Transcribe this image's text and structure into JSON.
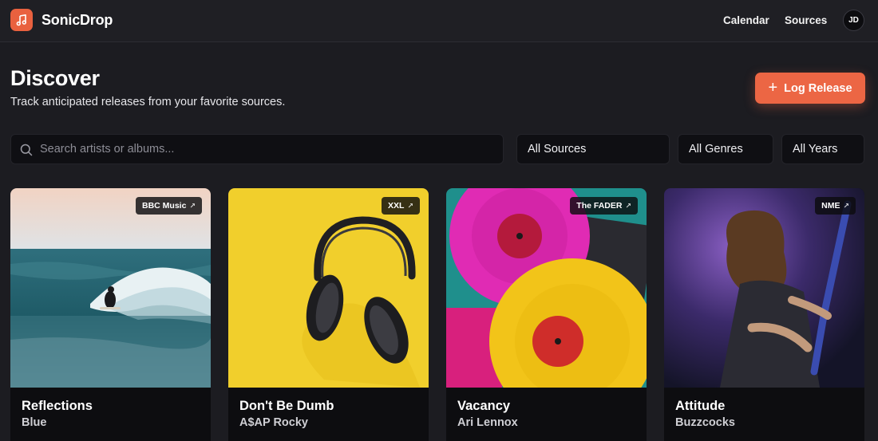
{
  "app": {
    "name": "SonicDrop",
    "logo_icon": "music-note-icon",
    "accent": "#ec6644"
  },
  "nav": {
    "calendar": "Calendar",
    "sources": "Sources",
    "avatar_initials": "JD"
  },
  "header": {
    "title": "Discover",
    "subtitle": "Track anticipated releases from your favorite sources.",
    "log_button": "Log Release"
  },
  "filters": {
    "search_placeholder": "Search artists or albums...",
    "sources": "All Sources",
    "genres": "All Genres",
    "years": "All Years"
  },
  "releases": [
    {
      "title": "Reflections",
      "artist": "Blue",
      "source": "BBC Music"
    },
    {
      "title": "Don't Be Dumb",
      "artist": "A$AP Rocky",
      "source": "XXL"
    },
    {
      "title": "Vacancy",
      "artist": "Ari Lennox",
      "source": "The FADER"
    },
    {
      "title": "Attitude",
      "artist": "Buzzcocks",
      "source": "NME"
    }
  ]
}
